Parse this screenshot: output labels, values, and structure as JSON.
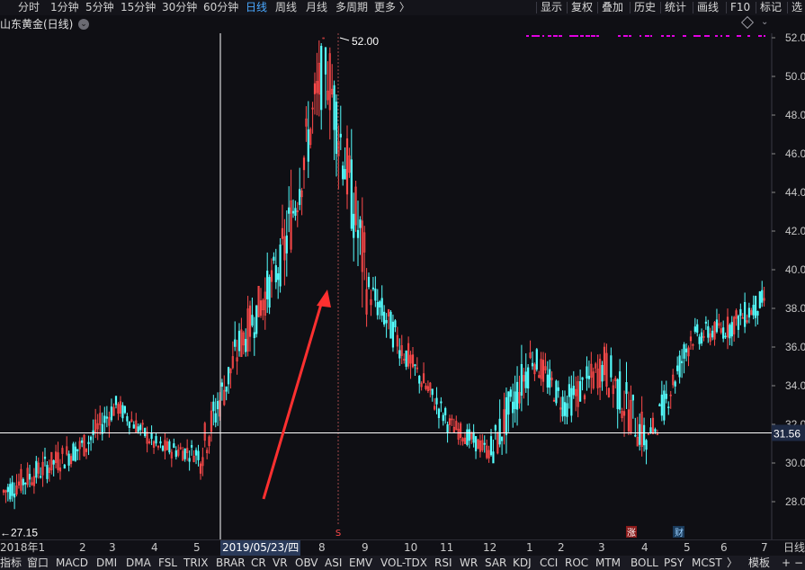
{
  "toolbar": {
    "periods": [
      "分时",
      "1分钟",
      "5分钟",
      "15分钟",
      "30分钟",
      "60分钟",
      "日线",
      "周线",
      "月线",
      "多周期",
      "更多 〉"
    ],
    "active_period": "日线",
    "actions": [
      "显示",
      "复权",
      "叠加",
      "历史",
      "统计",
      "画线",
      "F10",
      "标记",
      "选"
    ]
  },
  "title": {
    "name": "山东黄金(日线)"
  },
  "colors": {
    "up": "#ff4a4a",
    "down": "#54ffff",
    "bg": "#0f0f14",
    "grid": "#4a1a1a",
    "crosshair": "#ffffff",
    "arrow": "#ff3030",
    "magenta": "#e000e0"
  },
  "price_axis": {
    "ticks": [
      "52.00",
      "50.00",
      "48.00",
      "46.00",
      "44.00",
      "42.00",
      "40.00",
      "38.00",
      "36.00",
      "34.00",
      "32.00",
      "30.00",
      "28.00"
    ]
  },
  "crosshair": {
    "price_label": "31.56",
    "date_label": "2019/05/23/四"
  },
  "annotations": {
    "high_label": "52.00",
    "low_label": "27.15",
    "marker_s": "S",
    "marker_zhang": "涨",
    "marker_cai": "财"
  },
  "date_axis": {
    "labels": [
      "2018年1",
      "2",
      "3",
      "4",
      "5",
      "2019/05/23/四",
      "8",
      "9",
      "10",
      "11",
      "12",
      "1",
      "2",
      "3",
      "4",
      "5",
      "6",
      "7"
    ],
    "right_label": "日线"
  },
  "indicators": {
    "items": [
      "指标",
      "窗口",
      "MACD",
      "DMI",
      "DMA",
      "FSL",
      "TRIX",
      "BRAR",
      "CR",
      "VR",
      "OBV",
      "ASI",
      "EMV",
      "VOL-TDX",
      "RSI",
      "WR",
      "SAR",
      "KDJ",
      "CCI",
      "ROC",
      "MTM",
      "BOLL",
      "PSY",
      "MCST",
      "〉"
    ],
    "right": [
      "模板",
      "+",
      "−"
    ]
  },
  "chart_data": {
    "type": "candlestick",
    "title": "山东黄金(日线)",
    "ylim": [
      27.0,
      52.2
    ],
    "y_ticks": [
      52,
      50,
      48,
      46,
      44,
      42,
      40,
      38,
      36,
      34,
      32,
      30,
      28
    ],
    "high": 52.0,
    "low": 27.15,
    "crosshair_price": 31.56,
    "crosshair_date": "2019/05/23/四",
    "x_labels": [
      "2018年1",
      "2",
      "3",
      "4",
      "5",
      "6",
      "7",
      "8",
      "9",
      "10",
      "11",
      "12",
      "1",
      "2",
      "3",
      "4",
      "5",
      "6",
      "7"
    ],
    "segments": [
      {
        "from": "2018年1",
        "to": "2",
        "low": 27.2,
        "high": 32.5,
        "start": 28.5,
        "end": 31.0
      },
      {
        "from": "2",
        "to": "3",
        "low": 29.5,
        "high": 34.8,
        "start": 31.0,
        "end": 33.0
      },
      {
        "from": "3",
        "to": "4",
        "low": 29.5,
        "high": 33.5,
        "start": 33.0,
        "end": 30.8
      },
      {
        "from": "4",
        "to": "5",
        "low": 28.5,
        "high": 32.5,
        "start": 30.8,
        "end": 30.5
      },
      {
        "from": "5",
        "to": "6",
        "low": 29.0,
        "high": 37.5,
        "start": 30.5,
        "end": 36.0
      },
      {
        "from": "6",
        "to": "7",
        "low": 35.5,
        "high": 44.5,
        "start": 36.0,
        "end": 40.5
      },
      {
        "from": "7",
        "to": "8",
        "low": 38.5,
        "high": 52.0,
        "start": 40.5,
        "end": 51.0
      },
      {
        "from": "8",
        "to": "9",
        "low": 35.5,
        "high": 51.5,
        "start": 51.0,
        "end": 39.0
      },
      {
        "from": "9",
        "to": "10",
        "low": 34.0,
        "high": 40.8,
        "start": 39.0,
        "end": 35.0
      },
      {
        "from": "10",
        "to": "11",
        "low": 31.0,
        "high": 36.0,
        "start": 35.0,
        "end": 32.0
      },
      {
        "from": "11",
        "to": "12",
        "low": 28.8,
        "high": 32.5,
        "start": 32.0,
        "end": 30.5
      },
      {
        "from": "12",
        "to": "1",
        "low": 30.0,
        "high": 39.0,
        "start": 30.5,
        "end": 35.5
      },
      {
        "from": "1",
        "to": "2",
        "low": 30.0,
        "high": 36.0,
        "start": 35.5,
        "end": 33.0
      },
      {
        "from": "2",
        "to": "3",
        "low": 32.0,
        "high": 39.2,
        "start": 33.0,
        "end": 35.0
      },
      {
        "from": "3",
        "to": "4",
        "low": 27.9,
        "high": 37.5,
        "start": 35.0,
        "end": 31.0
      },
      {
        "from": "4",
        "to": "5",
        "low": 31.5,
        "high": 38.0,
        "start": 31.0,
        "end": 36.5
      },
      {
        "from": "5",
        "to": "6",
        "low": 35.5,
        "high": 40.3,
        "start": 36.5,
        "end": 37.0
      },
      {
        "from": "6",
        "to": "7",
        "low": 34.7,
        "high": 39.9,
        "start": 37.0,
        "end": 38.5
      }
    ]
  }
}
